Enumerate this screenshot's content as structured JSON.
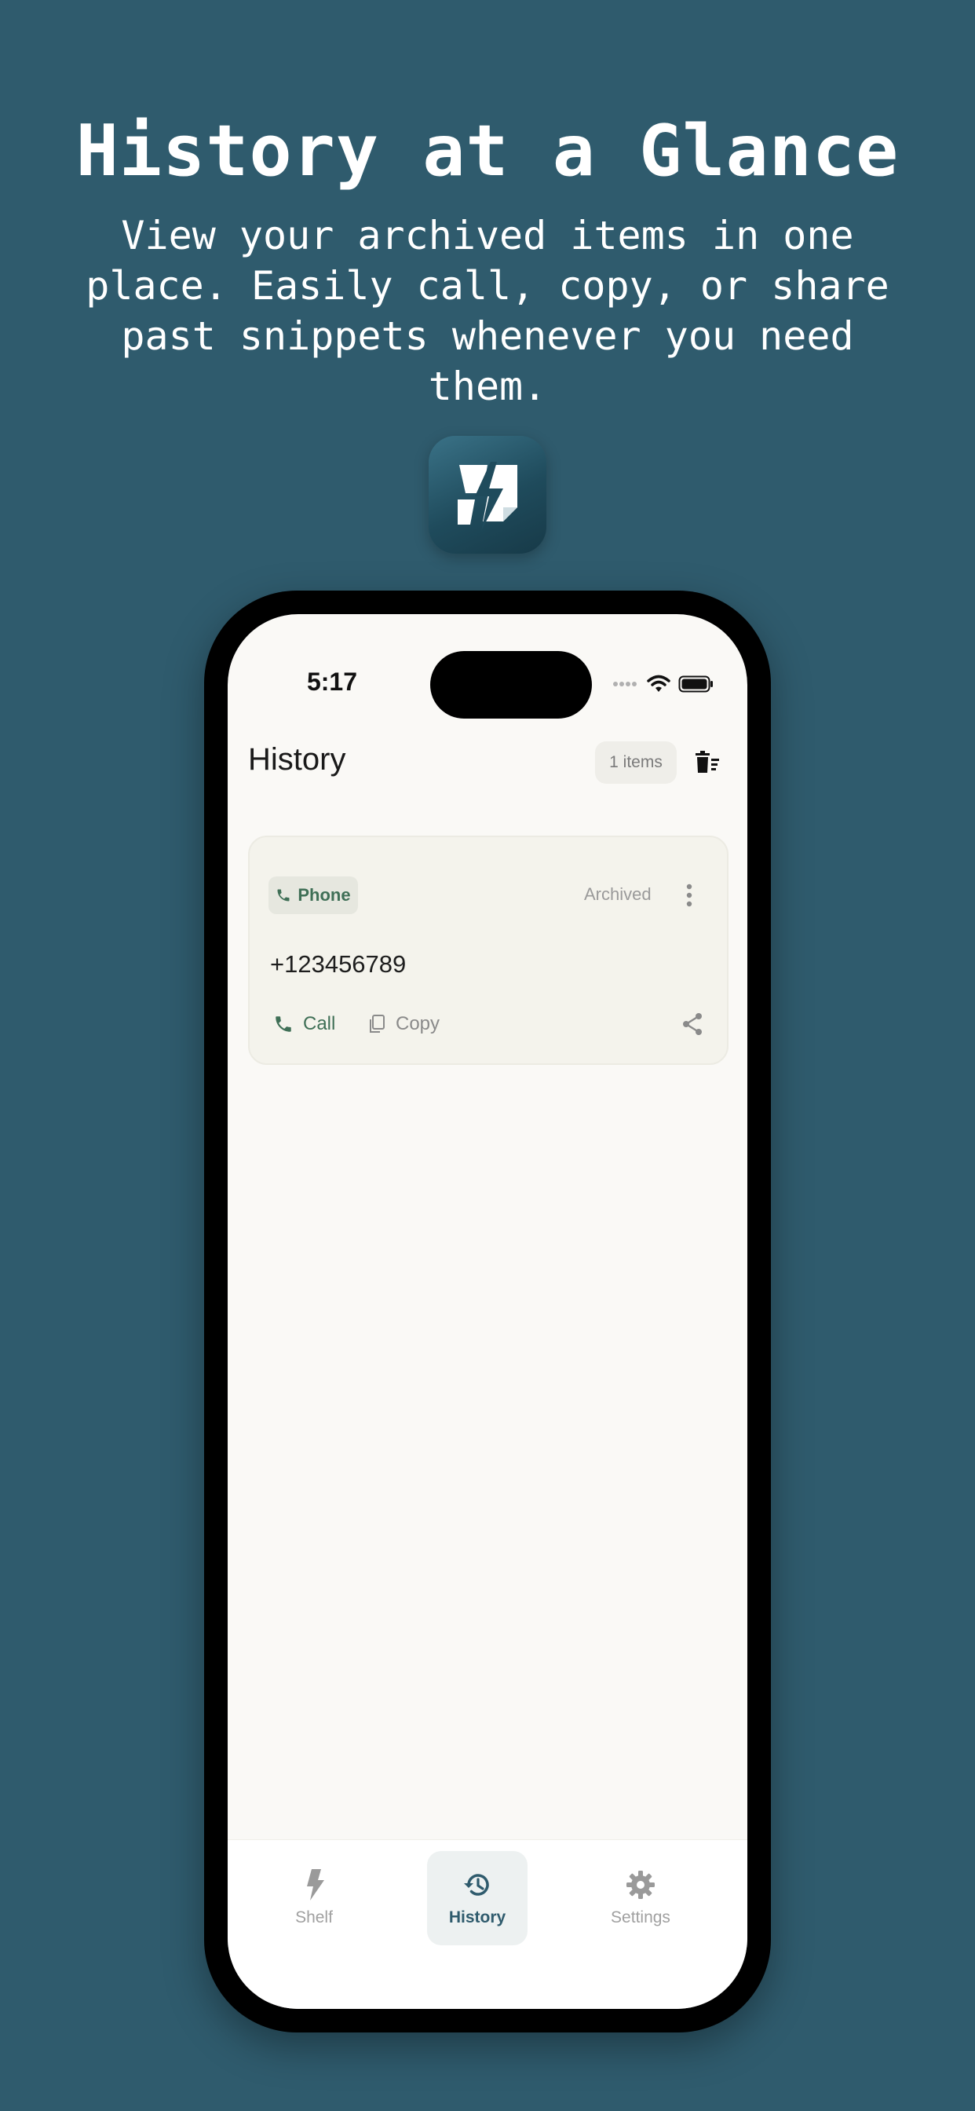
{
  "marketing": {
    "headline": "History at a Glance",
    "subhead": "View your archived items in one place. Easily call, copy, or share past snippets whenever you need them."
  },
  "status_bar": {
    "time": "5:17"
  },
  "header": {
    "title": "History",
    "count_label": "1 items"
  },
  "items": [
    {
      "type_label": "Phone",
      "status": "Archived",
      "value": "+123456789",
      "actions": {
        "call_label": "Call",
        "copy_label": "Copy"
      }
    }
  ],
  "bottom_nav": {
    "tabs": [
      {
        "label": "Shelf",
        "icon": "bolt-icon",
        "active": false
      },
      {
        "label": "History",
        "icon": "history-icon",
        "active": true
      },
      {
        "label": "Settings",
        "icon": "gear-icon",
        "active": false
      }
    ]
  },
  "colors": {
    "background": "#2f5b6d",
    "screen": "#faf9f6",
    "accent_green": "#3f6f56",
    "active_tab": "#2f5b6d"
  }
}
